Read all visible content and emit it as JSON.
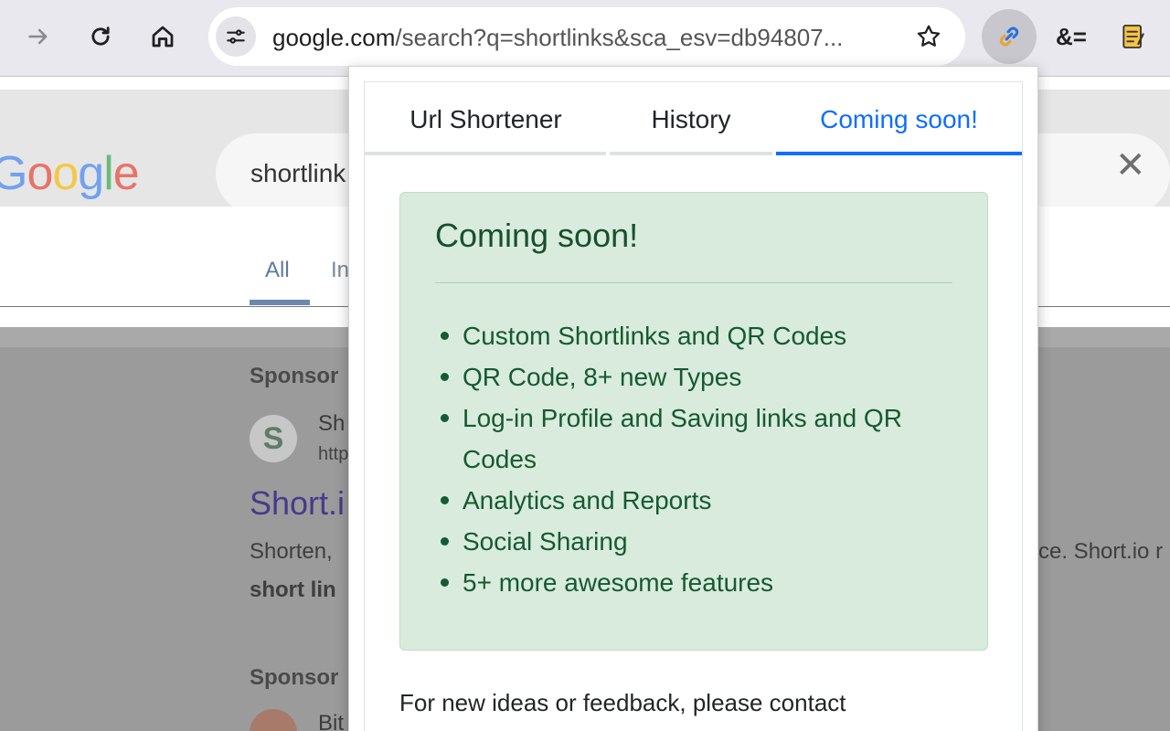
{
  "browser": {
    "url_host": "google.com",
    "url_path": "/search?q=shortlinks&sca_esv=db94807...",
    "extension_amp_label": "&="
  },
  "google": {
    "logo_text": "Google",
    "logo_colors": [
      "#4285f4",
      "#ea4335",
      "#fbbc05",
      "#4285f4",
      "#34a853",
      "#ea4335"
    ],
    "search_query": "shortlink",
    "tab_all": "All",
    "tab_images": "In",
    "sponsored_1": "Sponsor",
    "site_name": "Sh",
    "site_url": "http",
    "result_title": "Short.i",
    "snippet_left": "Shorten,",
    "snippet_right": "ce. Short.io r",
    "snippet_bold": "short lin",
    "sponsored_2": "Sponsor",
    "site_name_2": "Bit"
  },
  "popup": {
    "tabs": [
      {
        "label": "Url Shortener"
      },
      {
        "label": "History"
      },
      {
        "label": "Coming soon!"
      }
    ],
    "active_tab": 2,
    "heading": "Coming soon!",
    "features": [
      "Custom Shortlinks and QR Codes",
      "QR Code, 8+ new Types",
      "Log-in Profile and Saving links and QR Codes",
      "Analytics and Reports",
      "Social Sharing",
      "5+ more awesome features"
    ],
    "feedback": "For new ideas or feedback, please contact"
  },
  "colors": {
    "accent": "#0d6efd",
    "alert_bg": "#d9ebdc",
    "alert_text": "#145a32"
  }
}
